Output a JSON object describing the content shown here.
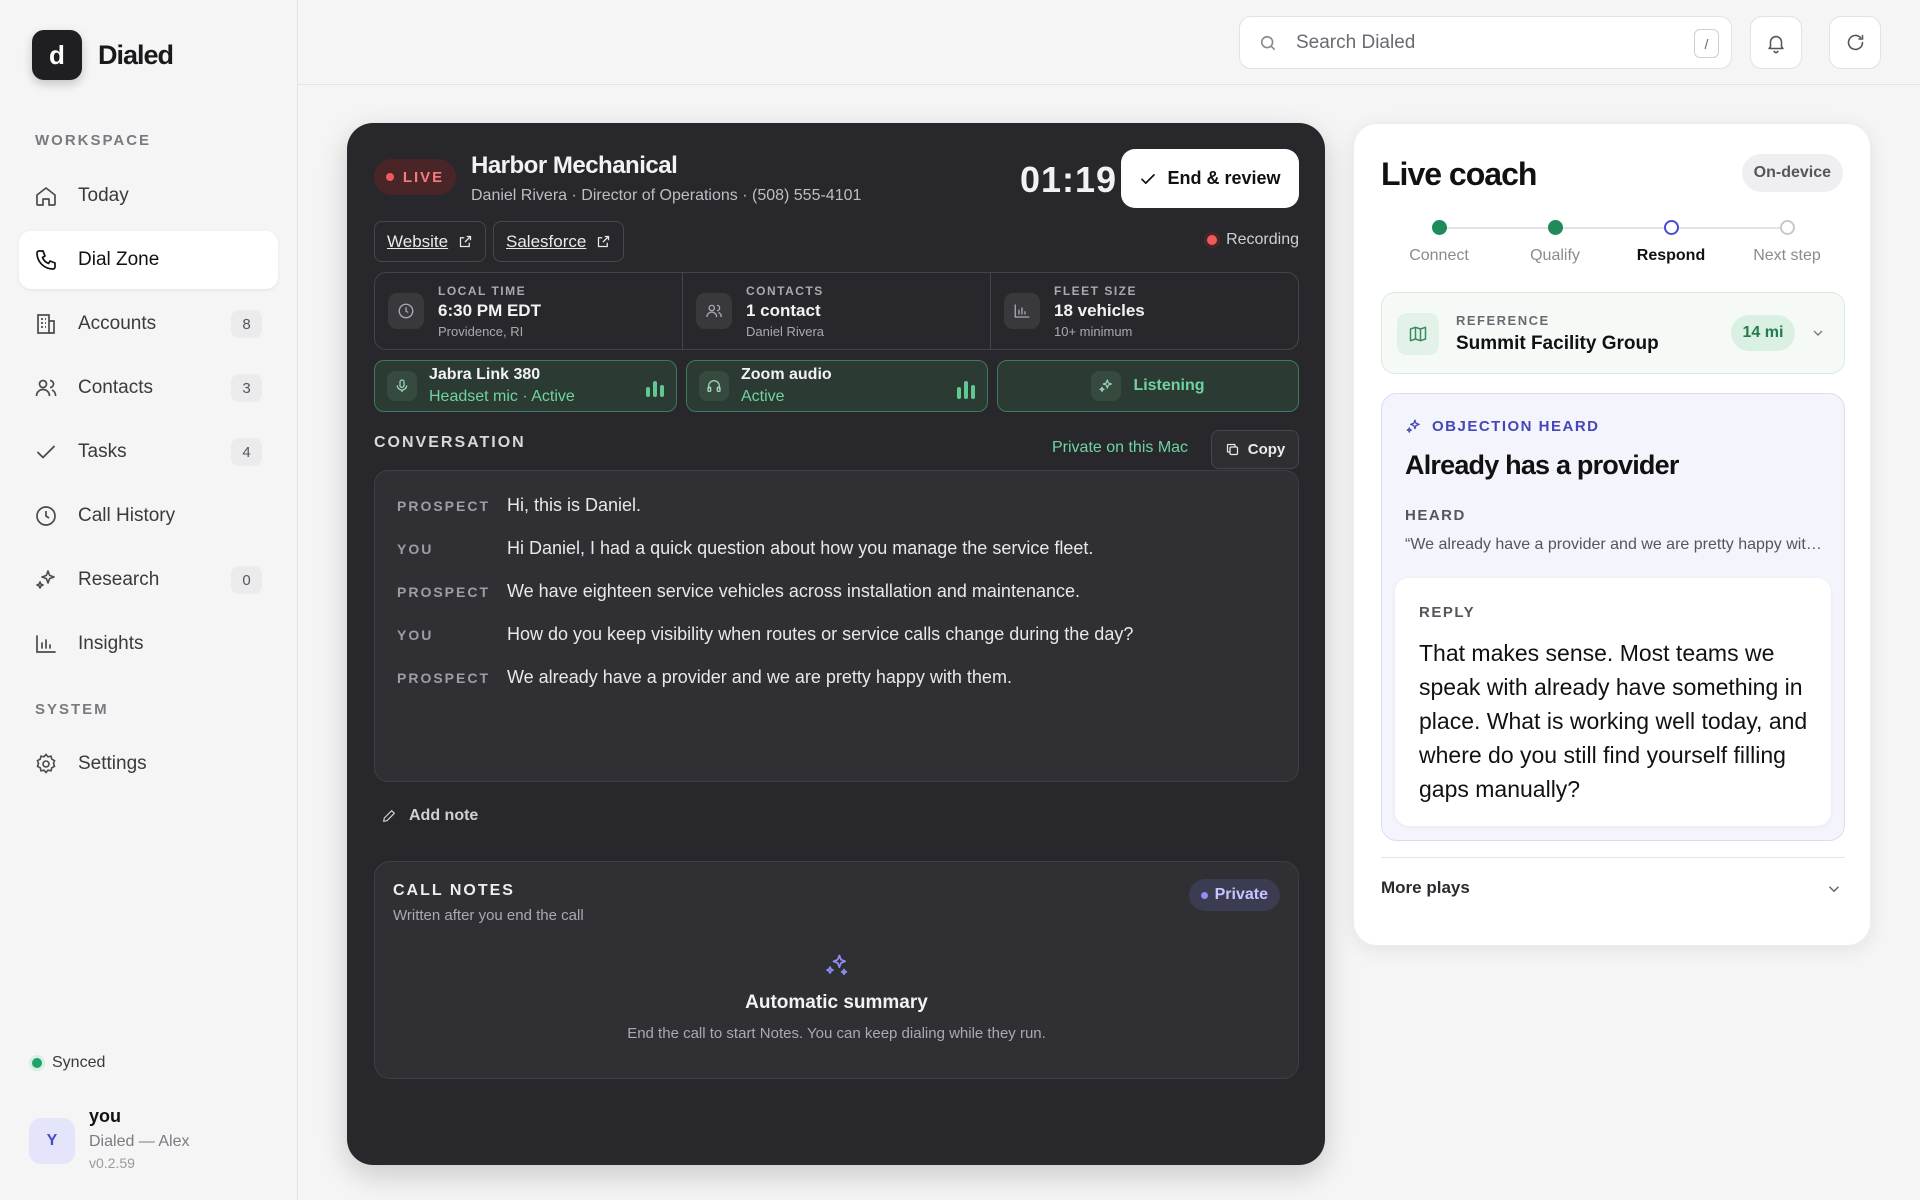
{
  "brand": {
    "logo_letter": "d",
    "name": "Dialed"
  },
  "sidebar": {
    "workspace_label": "WORKSPACE",
    "system_label": "SYSTEM",
    "items": [
      {
        "label": "Today",
        "icon": "home-icon"
      },
      {
        "label": "Dial Zone",
        "icon": "phone-icon",
        "active": true
      },
      {
        "label": "Accounts",
        "icon": "building-icon",
        "badge": "8"
      },
      {
        "label": "Contacts",
        "icon": "users-icon",
        "badge": "3"
      },
      {
        "label": "Tasks",
        "icon": "check-icon",
        "badge": "4"
      },
      {
        "label": "Call History",
        "icon": "clock-icon"
      },
      {
        "label": "Research",
        "icon": "sparkles-icon",
        "badge": "0"
      },
      {
        "label": "Insights",
        "icon": "bar-chart-icon"
      }
    ],
    "settings_label": "Settings",
    "sync_status": "Synced",
    "user": {
      "initial": "Y",
      "name": "you",
      "org": "Dialed — Alex",
      "version": "v0.2.59"
    }
  },
  "topbar": {
    "search_placeholder": "Search Dialed",
    "shortcut": "/"
  },
  "call": {
    "live_label": "LIVE",
    "company": "Harbor Mechanical",
    "contact_line": "Daniel Rivera · Director of Operations · (508) 555-4101",
    "timer": "01:19",
    "end_label": "End & review",
    "links": [
      "Website",
      "Salesforce"
    ],
    "recording_label": "Recording",
    "stats": [
      {
        "label": "LOCAL TIME",
        "value": "6:30 PM EDT",
        "sub": "Providence, RI",
        "icon": "clock-icon"
      },
      {
        "label": "CONTACTS",
        "value": "1 contact",
        "sub": "Daniel Rivera",
        "icon": "users-icon"
      },
      {
        "label": "FLEET SIZE",
        "value": "18 vehicles",
        "sub": "10+ minimum",
        "icon": "bar-chart-icon"
      }
    ],
    "devices": [
      {
        "name": "Jabra Link 380",
        "status": "Headset mic · Active",
        "icon": "microphone-icon"
      },
      {
        "name": "Zoom audio",
        "status": "Active",
        "icon": "headphones-icon"
      }
    ],
    "listening_label": "Listening",
    "conversation_label": "CONVERSATION",
    "privacy_note": "Private on this Mac",
    "copy_label": "Copy",
    "transcript": [
      {
        "speaker": "PROSPECT",
        "text": "Hi, this is Daniel."
      },
      {
        "speaker": "YOU",
        "text": "Hi Daniel, I had a quick question about how you manage the service fleet."
      },
      {
        "speaker": "PROSPECT",
        "text": "We have eighteen service vehicles across installation and maintenance."
      },
      {
        "speaker": "YOU",
        "text": "How do you keep visibility when routes or service calls change during the day?"
      },
      {
        "speaker": "PROSPECT",
        "text": "We already have a provider and we are pretty happy with them."
      }
    ],
    "add_note_label": "Add note",
    "notes": {
      "title": "CALL NOTES",
      "subtitle": "Written after you end the call",
      "private_label": "Private",
      "auto_title": "Automatic summary",
      "auto_sub": "End the call to start Notes. You can keep dialing while they run."
    }
  },
  "coach": {
    "title": "Live coach",
    "mode_label": "On-device",
    "steps": [
      {
        "label": "Connect",
        "state": "done"
      },
      {
        "label": "Qualify",
        "state": "done"
      },
      {
        "label": "Respond",
        "state": "current"
      },
      {
        "label": "Next step",
        "state": "todo"
      }
    ],
    "reference": {
      "label": "REFERENCE",
      "name": "Summit Facility Group",
      "distance": "14 mi"
    },
    "objection": {
      "label": "OBJECTION HEARD",
      "title": "Already has a provider",
      "heard_label": "HEARD",
      "heard_quote": "“We already have a provider and we are pretty happy with them.”",
      "reply_label": "REPLY",
      "reply_text": "That makes sense. Most teams we speak with already have something in place. What is working well today, and where do you still find yourself filling gaps manually?"
    },
    "more_label": "More plays"
  },
  "colors": {
    "accent_green": "#22a06b",
    "live_red": "#f05a5a",
    "indigo": "#4646b8",
    "dark_panel": "#28282c"
  }
}
